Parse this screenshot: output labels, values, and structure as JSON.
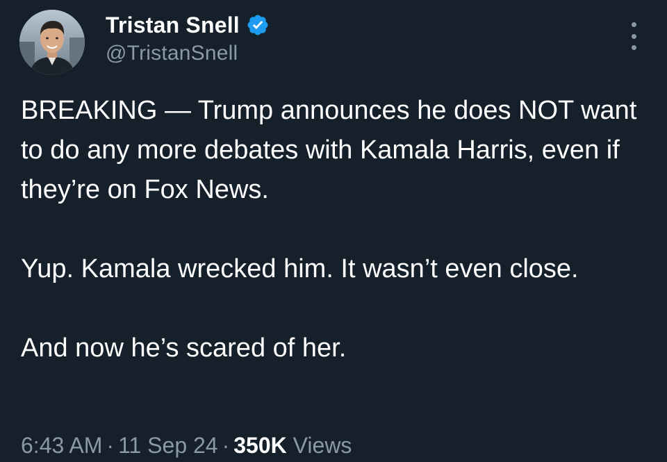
{
  "colors": {
    "background": "#15202b",
    "text_primary": "#ffffff",
    "text_secondary": "#8b98a5",
    "verified_badge": "#1d9bf0"
  },
  "author": {
    "display_name": "Tristan Snell",
    "handle": "@TristanSnell",
    "verified": true,
    "avatar_icon": "profile-photo",
    "verified_icon": "verified-badge-icon"
  },
  "menu": {
    "icon": "more-options-icon"
  },
  "tweet": {
    "paragraphs": [
      "BREAKING — Trump announces he does NOT want to do any more debates with Kamala Harris, even if they’re on Fox News.",
      "Yup. Kamala wrecked him. It wasn’t even close.",
      "And now he’s scared of her."
    ]
  },
  "meta": {
    "time": "6:43 AM",
    "separator": "·",
    "date": "11 Sep 24",
    "views_count": "350K",
    "views_label": "Views"
  }
}
